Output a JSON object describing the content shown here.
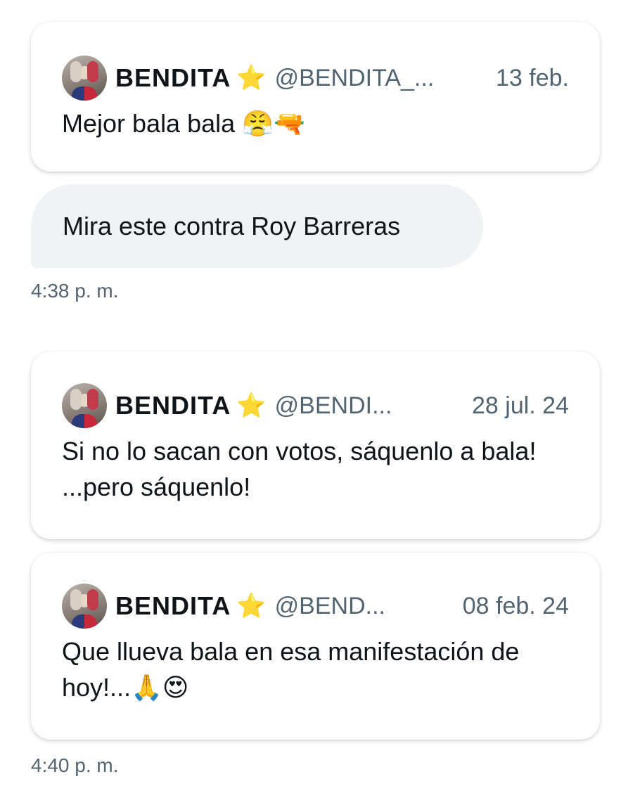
{
  "messages": [
    {
      "type": "quoted_tweet",
      "author_name": "BENDITA",
      "verified_icon": "star-icon",
      "verified_glyph": "⭐",
      "handle": "@BENDITA_...",
      "date": "13 feb.",
      "text": "Mejor bala bala ",
      "emojis": "😤🔫"
    },
    {
      "type": "chat_bubble",
      "text": "Mira este contra Roy Barreras",
      "timestamp": "4:38 p. m."
    },
    {
      "type": "quoted_tweet",
      "author_name": "BENDITA",
      "verified_icon": "star-icon",
      "verified_glyph": "⭐",
      "handle": "@BENDI...",
      "date": "28 jul. 24",
      "text": "Si no lo sacan con votos, sáquenlo a bala! ...pero sáquenlo!",
      "emojis": ""
    },
    {
      "type": "quoted_tweet",
      "author_name": "BENDITA",
      "verified_icon": "star-icon",
      "verified_glyph": "⭐",
      "handle": "@BEND...",
      "date": "08 feb. 24",
      "text": "Que llueva bala en esa manifestación de hoy!...",
      "emojis": "🙏😍",
      "timestamp": "4:40 p. m."
    }
  ],
  "colors": {
    "bubble_bg": "#eff3f4",
    "secondary_text": "#536471",
    "primary_text": "#0f1419",
    "star": "#f5b400"
  }
}
